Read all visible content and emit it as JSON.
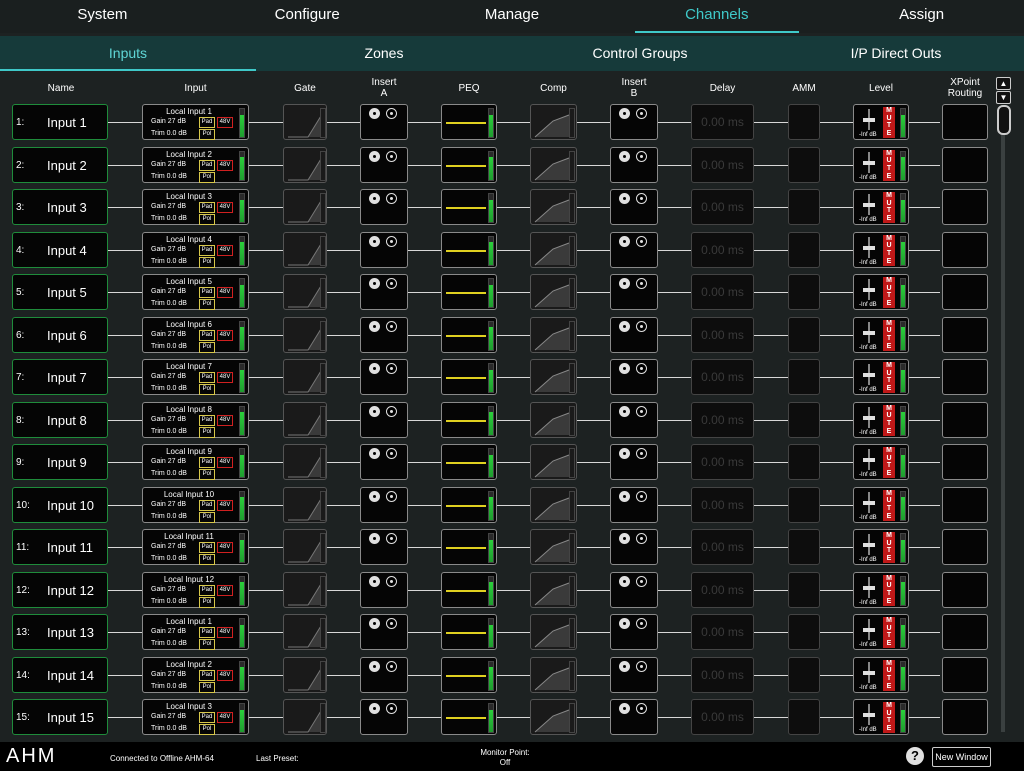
{
  "top_tabs": [
    {
      "label": "System"
    },
    {
      "label": "Configure"
    },
    {
      "label": "Manage"
    },
    {
      "label": "Channels"
    },
    {
      "label": "Assign"
    }
  ],
  "top_active": 3,
  "sub_tabs": [
    {
      "label": "Inputs"
    },
    {
      "label": "Zones"
    },
    {
      "label": "Control Groups"
    },
    {
      "label": "I/P Direct Outs"
    }
  ],
  "sub_active": 0,
  "columns": {
    "name": "Name",
    "input": "Input",
    "gate": "Gate",
    "insert_a": "Insert\nA",
    "peq": "PEQ",
    "comp": "Comp",
    "insert_b": "Insert\nB",
    "delay": "Delay",
    "amm": "AMM",
    "level": "Level",
    "xpoint": "XPoint\nRouting"
  },
  "labels": {
    "gain": "Gain 27 dB",
    "trim": "Trim 0.0 dB",
    "pad": "Pad",
    "pol": "Pol",
    "phantom": "48V",
    "delay": "0.00 ms",
    "level": "-Inf dB",
    "mute": "M\nU\nT\nE"
  },
  "rows": [
    {
      "num": "1:",
      "name": "Input 1",
      "src": "Local Input 1",
      "meter": 0.8
    },
    {
      "num": "2:",
      "name": "Input 2",
      "src": "Local Input 2",
      "meter": 0.8
    },
    {
      "num": "3:",
      "name": "Input 3",
      "src": "Local Input 3",
      "meter": 0.8
    },
    {
      "num": "4:",
      "name": "Input 4",
      "src": "Local Input 4",
      "meter": 0.8
    },
    {
      "num": "5:",
      "name": "Input 5",
      "src": "Local Input 5",
      "meter": 0.8
    },
    {
      "num": "6:",
      "name": "Input 6",
      "src": "Local Input 6",
      "meter": 0.8
    },
    {
      "num": "7:",
      "name": "Input 7",
      "src": "Local Input 7",
      "meter": 0.8
    },
    {
      "num": "8:",
      "name": "Input 8",
      "src": "Local Input 8",
      "meter": 0.8
    },
    {
      "num": "9:",
      "name": "Input 9",
      "src": "Local Input 9",
      "meter": 0.8
    },
    {
      "num": "10:",
      "name": "Input 10",
      "src": "Local Input 10",
      "meter": 0.8
    },
    {
      "num": "11:",
      "name": "Input 11",
      "src": "Local Input 11",
      "meter": 0.8
    },
    {
      "num": "12:",
      "name": "Input 12",
      "src": "Local Input 12",
      "meter": 0.8
    },
    {
      "num": "13:",
      "name": "Input 13",
      "src": "Local Input 1",
      "meter": 0.8
    },
    {
      "num": "14:",
      "name": "Input 14",
      "src": "Local Input 2",
      "meter": 0.8
    },
    {
      "num": "15:",
      "name": "Input 15",
      "src": "Local Input 3",
      "meter": 0.8
    }
  ],
  "status": {
    "logo": "AHM",
    "connection": "Connected to Offline AHM-64",
    "last_preset": "Last Preset:",
    "monitor_label": "Monitor Point:",
    "monitor_value": "Off",
    "help": "?",
    "new_window": "New Window"
  },
  "scroll": {
    "up": "▲",
    "down": "▼"
  },
  "colors": {
    "accent": "#3fc9c9",
    "name_border": "#1f8c3b",
    "mute": "#c01818",
    "peq_curve": "#e0d020"
  }
}
